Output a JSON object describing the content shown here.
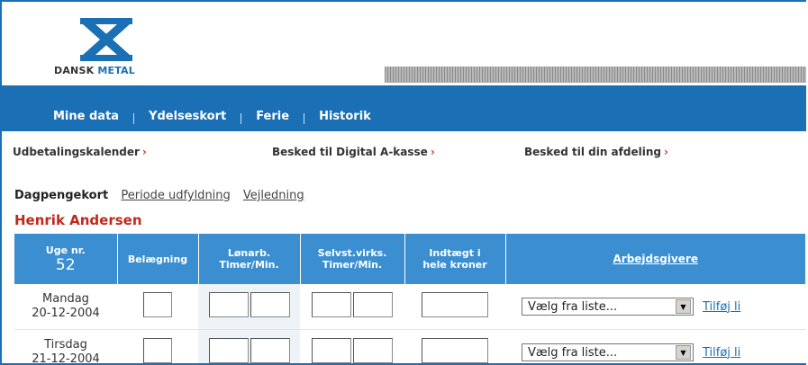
{
  "logo": {
    "text_part1": "DANSK ",
    "text_part2": "METAL"
  },
  "nav": {
    "items": [
      "Mine data",
      "Ydelseskort",
      "Ferie",
      "Historik"
    ]
  },
  "subnav": {
    "items": [
      "Udbetalingskalender",
      "Besked til Digital A-kasse",
      "Besked til din afdeling"
    ],
    "arrow": "›"
  },
  "tabs": {
    "active": "Dagpengekort",
    "links": [
      "Periode udfyldning",
      "Vejledning"
    ]
  },
  "person_name": "Henrik Andersen",
  "table": {
    "week_label": "Uge nr.",
    "week_number": "52",
    "col_belaegning": "Belægning",
    "col_lonarb_1": "Lønarb.",
    "col_lonarb_2": "Timer/Min.",
    "col_selvst_1": "Selvst.virks.",
    "col_selvst_2": "Timer/Min.",
    "col_indtaegt_1": "Indtægt i",
    "col_indtaegt_2": "hele kroner",
    "col_arbejdsgivere": "Arbejdsgivere",
    "rows": [
      {
        "day": "Mandag",
        "date": "20-12-2004",
        "select_value": "Vælg fra liste...",
        "add_link": "Tilføj li"
      },
      {
        "day": "Tirsdag",
        "date": "21-12-2004",
        "select_value": "Vælg fra liste...",
        "add_link": "Tilføj li"
      }
    ]
  },
  "icons": {
    "logo": "dansk-metal-logo",
    "dropdown": "chevron-down-icon",
    "arrow": "arrow-right-icon"
  },
  "colors": {
    "brand_blue": "#1a6fb5",
    "header_blue": "#3b8fd1",
    "accent_red": "#c0281c"
  }
}
